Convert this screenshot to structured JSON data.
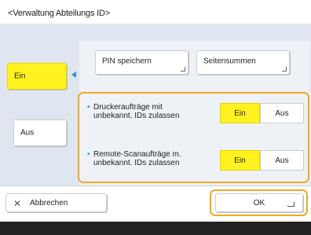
{
  "header": {
    "title": "<Verwaltung Abteilungs ID>"
  },
  "mode": {
    "on_label": "Ein",
    "off_label": "Aus"
  },
  "top_buttons": {
    "pin_save": "PIN speichern",
    "page_totals": "Seitensummen"
  },
  "options": [
    {
      "label_line1": "Druckeraufträge mit",
      "label_line2": "unbekannt. IDs zulassen",
      "on": "Ein",
      "off": "Aus"
    },
    {
      "label_line1": "Remote-Scanaufträge m.",
      "label_line2": "unbekannt. IDs zulassen",
      "on": "Ein",
      "off": "Aus"
    }
  ],
  "footer": {
    "cancel_label": "Abbrechen",
    "ok_label": "OK"
  },
  "colors": {
    "selected": "#fff21f",
    "highlight_border": "#f5a623",
    "accent": "#2f8fe0"
  }
}
